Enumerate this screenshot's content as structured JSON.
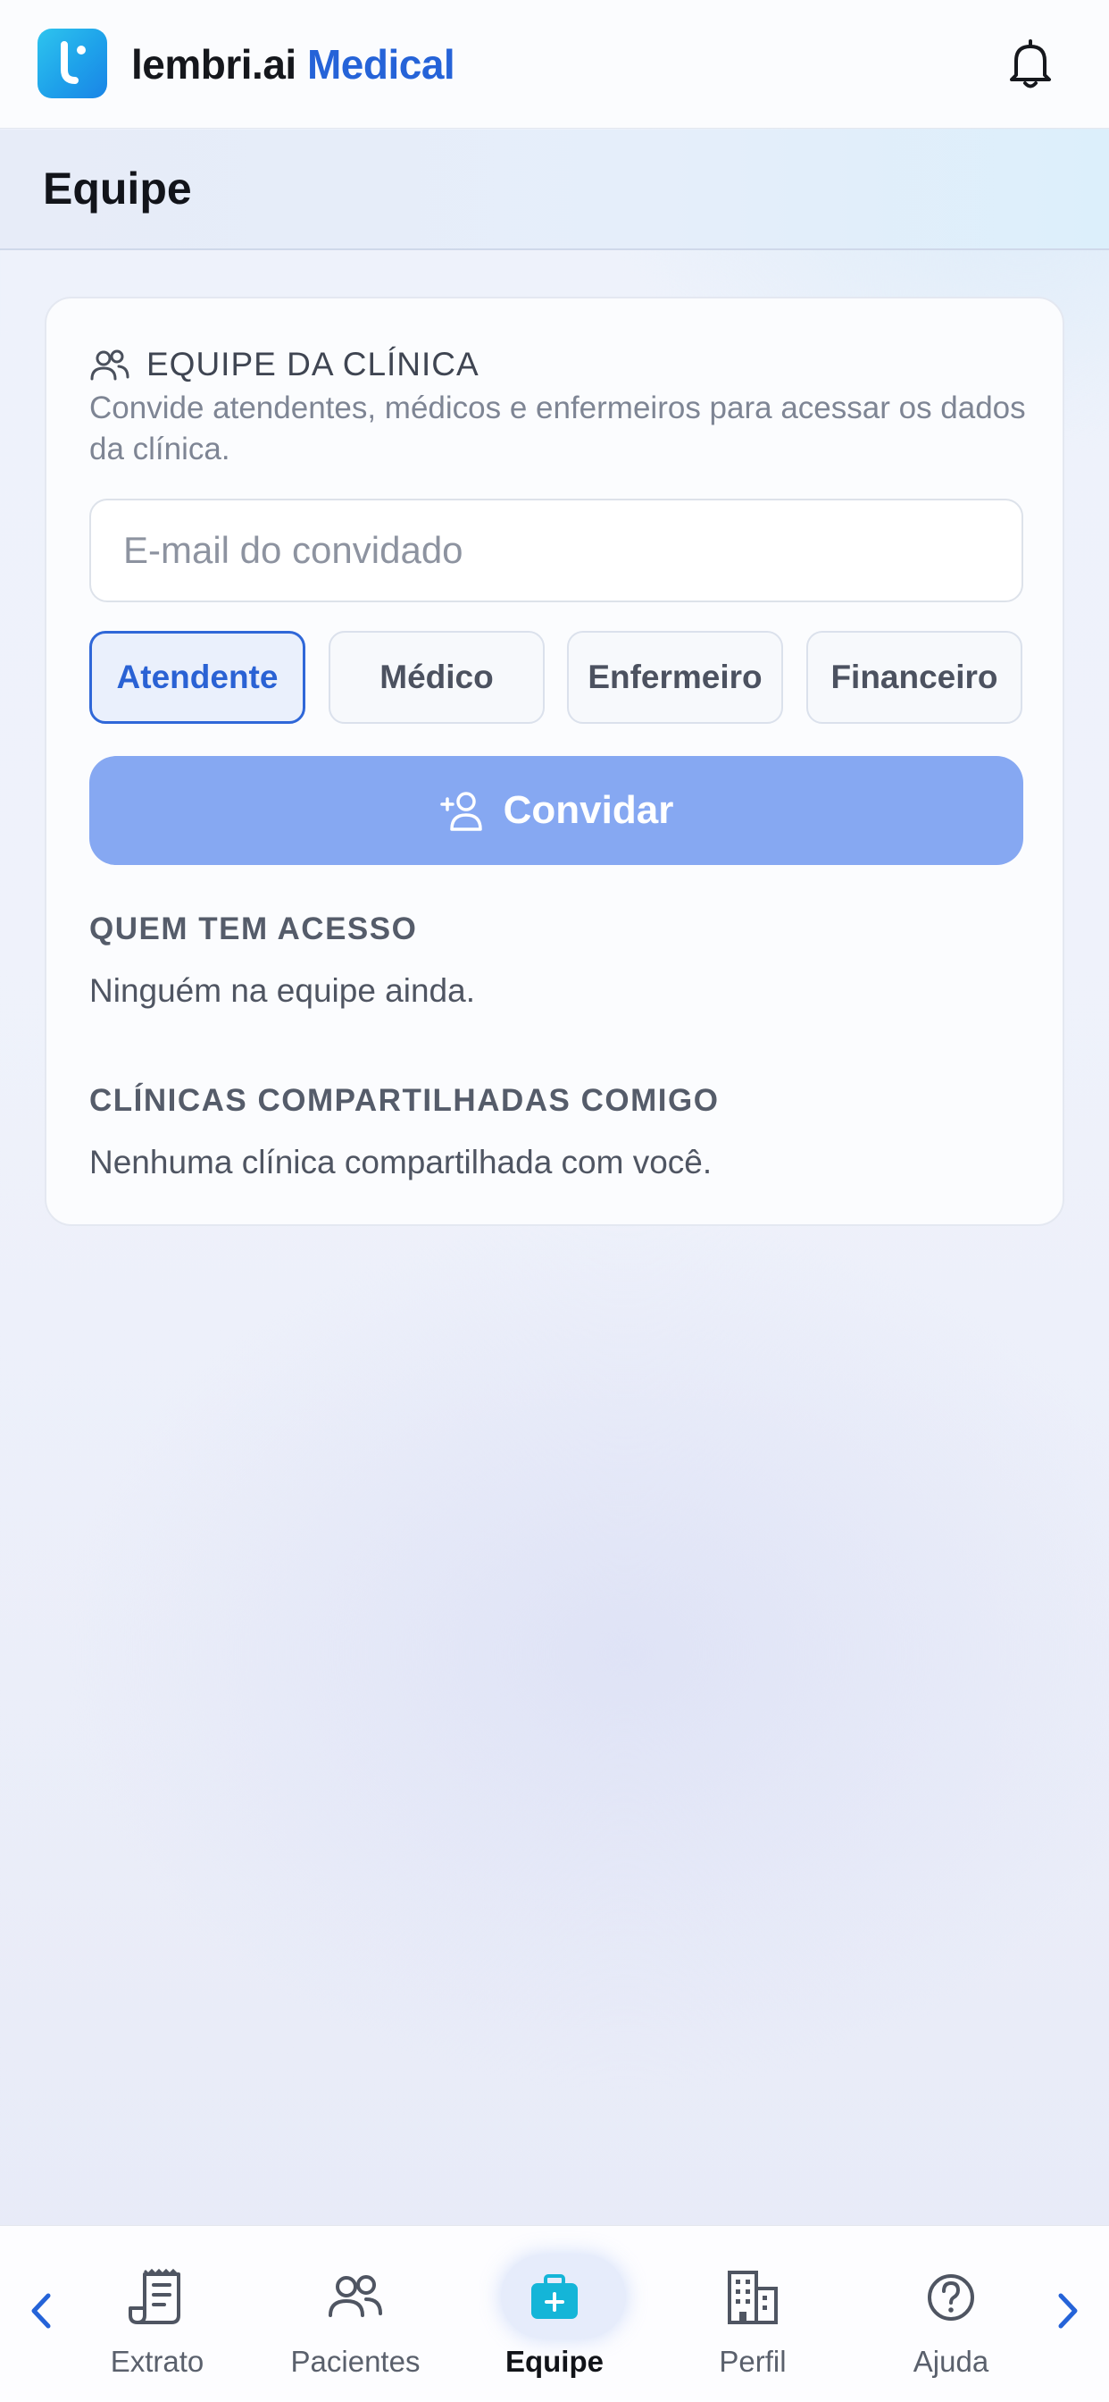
{
  "app": {
    "brand_primary": "lembri.ai",
    "brand_secondary": "Medical",
    "accent_color": "#2563d8"
  },
  "header": {
    "title": "Equipe"
  },
  "team_card": {
    "title": "EQUIPE DA CLÍNICA",
    "description": "Convide atendentes, médicos e enfermeiros para acessar os dados da clínica.",
    "email_placeholder": "E-mail do convidado",
    "email_value": "",
    "roles": [
      {
        "label": "Atendente",
        "selected": true
      },
      {
        "label": "Médico",
        "selected": false
      },
      {
        "label": "Enfermeiro",
        "selected": false
      },
      {
        "label": "Financeiro",
        "selected": false
      }
    ],
    "invite_label": "Convidar",
    "access_heading": "QUEM TEM ACESSO",
    "access_empty": "Ninguém na equipe ainda.",
    "shared_heading": "CLÍNICAS COMPARTILHADAS COMIGO",
    "shared_empty": "Nenhuma clínica compartilhada com você."
  },
  "bottom_nav": {
    "items": [
      {
        "label": "Extrato",
        "icon": "receipt-icon"
      },
      {
        "label": "Pacientes",
        "icon": "users-icon"
      },
      {
        "label": "Equipe",
        "icon": "medical-kit-icon",
        "active": true
      },
      {
        "label": "Perfil",
        "icon": "building-icon"
      },
      {
        "label": "Ajuda",
        "icon": "help-circle-icon"
      }
    ]
  }
}
